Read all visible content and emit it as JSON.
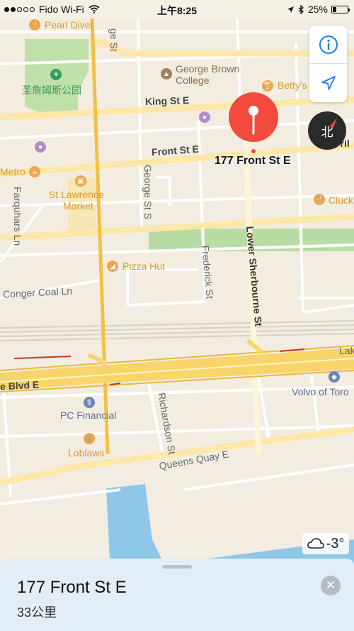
{
  "status_bar": {
    "carrier": "Fido Wi-Fi",
    "time": "上午8:25",
    "battery": "25%",
    "battery_level": 0.25,
    "signal_bars": 2
  },
  "map": {
    "streets": {
      "king": "King St E",
      "front": "Front St E",
      "george": "George St S",
      "george_top": "ge St",
      "lower_sherbourne": "Lower Sherbourne St",
      "frederick": "Frederick St",
      "farquhars": "Farquhars Ln",
      "conger": "Conger Coal Ln",
      "richardson": "Richardson St",
      "queens_quay": "Queens Quay E",
      "blvd": "e Blvd E",
      "lake": "Lak",
      "front_right": "Fril"
    },
    "pois": {
      "pearl_diver": "Pearl Diver",
      "st_james_park": "圣詹姆斯公园",
      "george_brown_1": "George Brown",
      "george_brown_2": "College",
      "bettys": "Betty's",
      "metro": "Metro",
      "st_lawrence_1": "St Lawrence",
      "st_lawrence_2": "Market",
      "pizza_hut": "Pizza Hut",
      "pc_financial": "PC Financial",
      "loblaws": "Loblaws",
      "volvo": "Volvo of Toro",
      "cluck": "Cluck"
    },
    "pin": {
      "label": "177 Front St E",
      "color": "#f24a3d"
    }
  },
  "controls": {
    "info_icon": "info-icon",
    "location_icon": "location-arrow-icon",
    "compass_label": "北"
  },
  "weather": {
    "temperature": "-3°",
    "icon": "cloud-icon"
  },
  "sheet": {
    "title": "177 Front St E",
    "distance": "33公里",
    "close_icon": "close-icon"
  },
  "colors": {
    "land": "#f3ede1",
    "highway": "#f7d56a",
    "major_road": "#fbe4a0",
    "park": "#b9dca4",
    "water": "#8fc7e8",
    "pin": "#f24a3d",
    "accent": "#1e7cf2"
  }
}
